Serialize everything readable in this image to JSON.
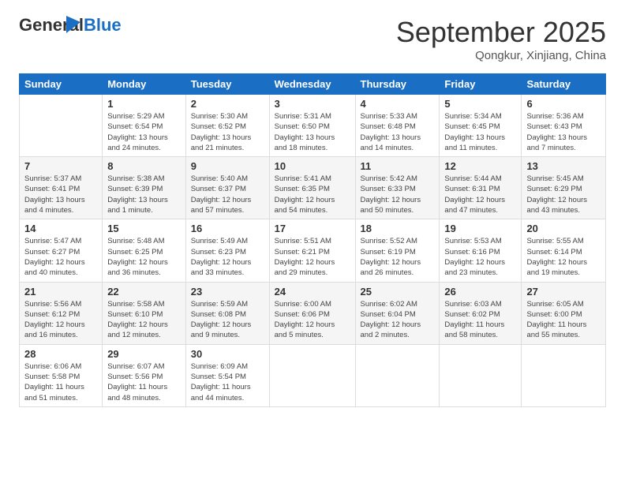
{
  "logo": {
    "general": "General",
    "blue": "Blue"
  },
  "title": "September 2025",
  "location": "Qongkur, Xinjiang, China",
  "days_of_week": [
    "Sunday",
    "Monday",
    "Tuesday",
    "Wednesday",
    "Thursday",
    "Friday",
    "Saturday"
  ],
  "weeks": [
    [
      {
        "day": "",
        "info": ""
      },
      {
        "day": "1",
        "info": "Sunrise: 5:29 AM\nSunset: 6:54 PM\nDaylight: 13 hours\nand 24 minutes."
      },
      {
        "day": "2",
        "info": "Sunrise: 5:30 AM\nSunset: 6:52 PM\nDaylight: 13 hours\nand 21 minutes."
      },
      {
        "day": "3",
        "info": "Sunrise: 5:31 AM\nSunset: 6:50 PM\nDaylight: 13 hours\nand 18 minutes."
      },
      {
        "day": "4",
        "info": "Sunrise: 5:33 AM\nSunset: 6:48 PM\nDaylight: 13 hours\nand 14 minutes."
      },
      {
        "day": "5",
        "info": "Sunrise: 5:34 AM\nSunset: 6:45 PM\nDaylight: 13 hours\nand 11 minutes."
      },
      {
        "day": "6",
        "info": "Sunrise: 5:36 AM\nSunset: 6:43 PM\nDaylight: 13 hours\nand 7 minutes."
      }
    ],
    [
      {
        "day": "7",
        "info": "Sunrise: 5:37 AM\nSunset: 6:41 PM\nDaylight: 13 hours\nand 4 minutes."
      },
      {
        "day": "8",
        "info": "Sunrise: 5:38 AM\nSunset: 6:39 PM\nDaylight: 13 hours\nand 1 minute."
      },
      {
        "day": "9",
        "info": "Sunrise: 5:40 AM\nSunset: 6:37 PM\nDaylight: 12 hours\nand 57 minutes."
      },
      {
        "day": "10",
        "info": "Sunrise: 5:41 AM\nSunset: 6:35 PM\nDaylight: 12 hours\nand 54 minutes."
      },
      {
        "day": "11",
        "info": "Sunrise: 5:42 AM\nSunset: 6:33 PM\nDaylight: 12 hours\nand 50 minutes."
      },
      {
        "day": "12",
        "info": "Sunrise: 5:44 AM\nSunset: 6:31 PM\nDaylight: 12 hours\nand 47 minutes."
      },
      {
        "day": "13",
        "info": "Sunrise: 5:45 AM\nSunset: 6:29 PM\nDaylight: 12 hours\nand 43 minutes."
      }
    ],
    [
      {
        "day": "14",
        "info": "Sunrise: 5:47 AM\nSunset: 6:27 PM\nDaylight: 12 hours\nand 40 minutes."
      },
      {
        "day": "15",
        "info": "Sunrise: 5:48 AM\nSunset: 6:25 PM\nDaylight: 12 hours\nand 36 minutes."
      },
      {
        "day": "16",
        "info": "Sunrise: 5:49 AM\nSunset: 6:23 PM\nDaylight: 12 hours\nand 33 minutes."
      },
      {
        "day": "17",
        "info": "Sunrise: 5:51 AM\nSunset: 6:21 PM\nDaylight: 12 hours\nand 29 minutes."
      },
      {
        "day": "18",
        "info": "Sunrise: 5:52 AM\nSunset: 6:19 PM\nDaylight: 12 hours\nand 26 minutes."
      },
      {
        "day": "19",
        "info": "Sunrise: 5:53 AM\nSunset: 6:16 PM\nDaylight: 12 hours\nand 23 minutes."
      },
      {
        "day": "20",
        "info": "Sunrise: 5:55 AM\nSunset: 6:14 PM\nDaylight: 12 hours\nand 19 minutes."
      }
    ],
    [
      {
        "day": "21",
        "info": "Sunrise: 5:56 AM\nSunset: 6:12 PM\nDaylight: 12 hours\nand 16 minutes."
      },
      {
        "day": "22",
        "info": "Sunrise: 5:58 AM\nSunset: 6:10 PM\nDaylight: 12 hours\nand 12 minutes."
      },
      {
        "day": "23",
        "info": "Sunrise: 5:59 AM\nSunset: 6:08 PM\nDaylight: 12 hours\nand 9 minutes."
      },
      {
        "day": "24",
        "info": "Sunrise: 6:00 AM\nSunset: 6:06 PM\nDaylight: 12 hours\nand 5 minutes."
      },
      {
        "day": "25",
        "info": "Sunrise: 6:02 AM\nSunset: 6:04 PM\nDaylight: 12 hours\nand 2 minutes."
      },
      {
        "day": "26",
        "info": "Sunrise: 6:03 AM\nSunset: 6:02 PM\nDaylight: 11 hours\nand 58 minutes."
      },
      {
        "day": "27",
        "info": "Sunrise: 6:05 AM\nSunset: 6:00 PM\nDaylight: 11 hours\nand 55 minutes."
      }
    ],
    [
      {
        "day": "28",
        "info": "Sunrise: 6:06 AM\nSunset: 5:58 PM\nDaylight: 11 hours\nand 51 minutes."
      },
      {
        "day": "29",
        "info": "Sunrise: 6:07 AM\nSunset: 5:56 PM\nDaylight: 11 hours\nand 48 minutes."
      },
      {
        "day": "30",
        "info": "Sunrise: 6:09 AM\nSunset: 5:54 PM\nDaylight: 11 hours\nand 44 minutes."
      },
      {
        "day": "",
        "info": ""
      },
      {
        "day": "",
        "info": ""
      },
      {
        "day": "",
        "info": ""
      },
      {
        "day": "",
        "info": ""
      }
    ]
  ]
}
